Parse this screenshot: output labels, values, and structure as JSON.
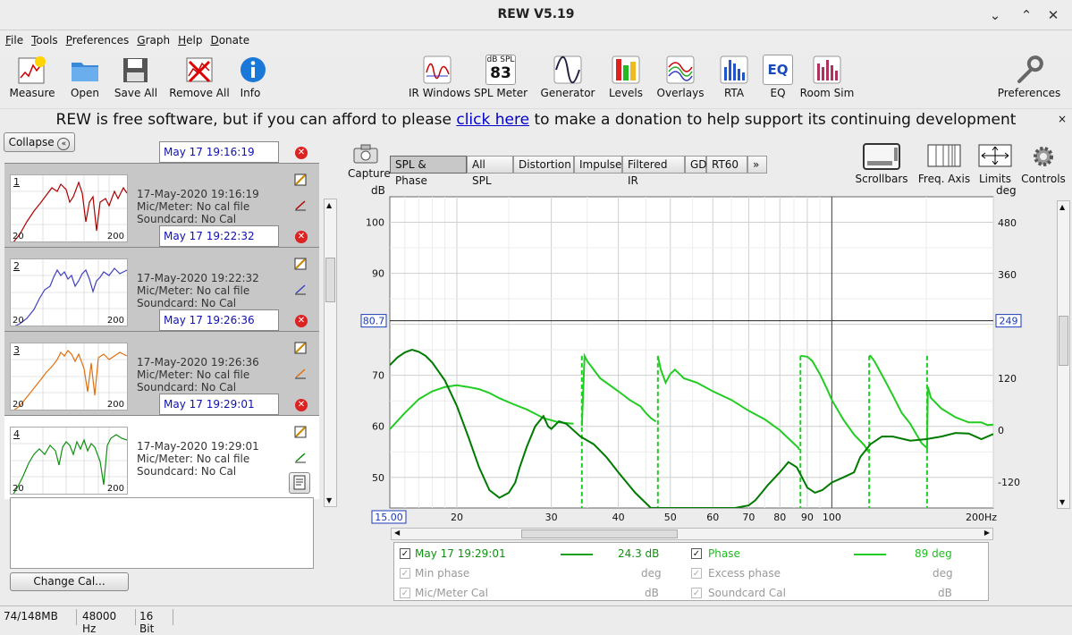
{
  "window": {
    "title": "REW V5.19"
  },
  "menu": [
    "File",
    "Tools",
    "Preferences",
    "Graph",
    "Help",
    "Donate"
  ],
  "toolbar": {
    "measure": "Measure",
    "open": "Open",
    "save_all": "Save All",
    "remove_all": "Remove All",
    "info": "Info",
    "ir_windows": "IR Windows",
    "spl_meter": "SPL Meter",
    "spl_label": "dB SPL",
    "spl_value": "83",
    "generator": "Generator",
    "levels": "Levels",
    "overlays": "Overlays",
    "rta": "RTA",
    "eq": "EQ",
    "eq_icon": "EQ",
    "room_sim": "Room Sim",
    "preferences": "Preferences"
  },
  "banner": {
    "before": "REW is free software, but if you can afford to please ",
    "link": "click here",
    "after": " to make a donation to help support its continuing development",
    "close": "×"
  },
  "left": {
    "collapse": "Collapse",
    "change_cal": "Change Cal...",
    "thumb_axis": [
      "20",
      "200"
    ]
  },
  "measurements": [
    {
      "num": "1",
      "name": "May 17 19:16:19",
      "date": "17-May-2020 19:16:19",
      "mic": "Mic/Meter: No cal file",
      "card": "Soundcard: No Cal",
      "color": "#b00000"
    },
    {
      "num": "2",
      "name": "May 17 19:22:32",
      "date": "17-May-2020 19:22:32",
      "mic": "Mic/Meter: No cal file",
      "card": "Soundcard: No Cal",
      "color": "#4040c0"
    },
    {
      "num": "3",
      "name": "May 17 19:26:36",
      "date": "17-May-2020 19:26:36",
      "mic": "Mic/Meter: No cal file",
      "card": "Soundcard: No Cal",
      "color": "#e07010"
    },
    {
      "num": "4",
      "name": "May 17 19:29:01",
      "date": "17-May-2020 19:29:01",
      "mic": "Mic/Meter: No cal file",
      "card": "Soundcard: No Cal",
      "color": "#109010"
    }
  ],
  "graph": {
    "capture": "Capture",
    "tabs": [
      "SPL & Phase",
      "All SPL",
      "Distortion",
      "Impulse",
      "Filtered IR",
      "GD",
      "RT60",
      "»"
    ],
    "right_tools": {
      "scrollbars": "Scrollbars",
      "freq_axis": "Freq. Axis",
      "limits": "Limits",
      "controls": "Controls"
    },
    "left_unit": "dB",
    "right_unit": "deg",
    "y_left_ticks": [
      {
        "v": 100,
        "label": "100"
      },
      {
        "v": 90,
        "label": "90"
      },
      {
        "v": 70,
        "label": "70"
      },
      {
        "v": 60,
        "label": "60"
      },
      {
        "v": 50,
        "label": "50"
      }
    ],
    "y_right_ticks": [
      {
        "v": 480,
        "label": "480"
      },
      {
        "v": 360,
        "label": "360"
      },
      {
        "v": 120,
        "label": "120"
      },
      {
        "v": 0,
        "label": "0"
      },
      {
        "v": -120,
        "label": "-120"
      }
    ],
    "x_ticks": [
      {
        "v": 20,
        "label": "20"
      },
      {
        "v": 30,
        "label": "30"
      },
      {
        "v": 40,
        "label": "40"
      },
      {
        "v": 50,
        "label": "50"
      },
      {
        "v": 60,
        "label": "60"
      },
      {
        "v": 70,
        "label": "70"
      },
      {
        "v": 80,
        "label": "80"
      },
      {
        "v": 90,
        "label": "90"
      },
      {
        "v": 100,
        "label": "100"
      },
      {
        "v": 200,
        "label": "200Hz"
      }
    ],
    "x_min_label": "15.00",
    "cursor_left": "80.7",
    "cursor_right": "249",
    "x_range": [
      15,
      200
    ],
    "y_range": [
      44,
      105
    ],
    "phase_range": [
      -180,
      540
    ],
    "cursor_freq": 100,
    "cursor_db": 80.7
  },
  "legend": {
    "name": "May 17 19:29:01",
    "spl_value": "24.3 dB",
    "phase": "Phase",
    "phase_value": "89 deg",
    "min_phase": "Min phase",
    "min_phase_unit": "deg",
    "excess_phase": "Excess phase",
    "excess_unit": "deg",
    "mic_cal": "Mic/Meter Cal",
    "mic_unit": "dB",
    "card_cal": "Soundcard Cal",
    "card_unit": "dB"
  },
  "status": {
    "memory": "74/148MB",
    "rate": "48000 Hz",
    "bits": "16 Bit"
  },
  "colors": {
    "spl": "#22cc22",
    "phase": "#007a00",
    "link": "#0000cc"
  }
}
